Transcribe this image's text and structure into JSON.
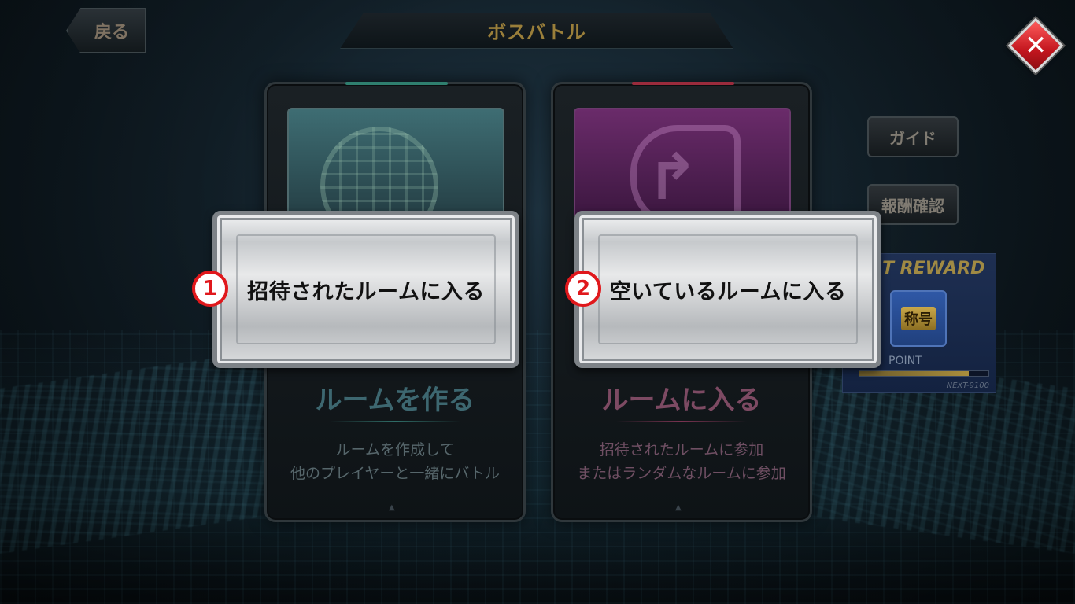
{
  "header": {
    "title": "ボスバトル",
    "back_label": "戻る",
    "close_icon": "close-icon"
  },
  "side_buttons": {
    "guide": "ガイド",
    "reward_check": "報酬確認"
  },
  "reward_panel": {
    "title": "T REWARD",
    "badge": "称号",
    "point_label": "POINT",
    "next": "NEXT-9100",
    "progress": 0.85
  },
  "cards": [
    {
      "heading": "ルームを作る",
      "desc_line1": "ルームを作成して",
      "desc_line2": "他のプレイヤーと一緒にバトル",
      "icon": "globe-icon"
    },
    {
      "heading": "ルームに入る",
      "desc_line1": "招待されたルームに参加",
      "desc_line2": "またはランダムなルームに参加",
      "icon": "enter-room-icon"
    }
  ],
  "overlay_buttons": [
    {
      "step": "1",
      "label": "招待されたルームに入る"
    },
    {
      "step": "2",
      "label": "空いているルームに入る"
    }
  ],
  "colors": {
    "title_gold": "#9a7f3a",
    "step_red": "#e0181c",
    "close_red": "#c3161e"
  }
}
